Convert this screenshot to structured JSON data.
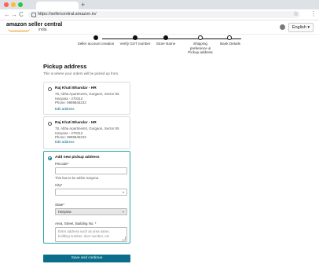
{
  "browser": {
    "url": "https://sellercentral.amazon.in/",
    "new_tab_symbol": "+",
    "back_icon": "←",
    "forward_icon": "→",
    "reload_icon": "C",
    "star_icon": "☆",
    "menu_icon": "⋮"
  },
  "header": {
    "logo_text": "amazon seller central",
    "logo_subtext": "india",
    "language": "English ▾"
  },
  "stepper": {
    "steps": [
      {
        "label": "Seller account creation",
        "status": "done"
      },
      {
        "label": "Verify GST number",
        "status": "done"
      },
      {
        "label": "Store Name",
        "status": "done"
      },
      {
        "label": "Shipping preference & Pickup address",
        "status": "current"
      },
      {
        "label": "Bank Details",
        "status": "todo"
      }
    ]
  },
  "page": {
    "title": "Pickup address",
    "subtitle": "This is where your orders will be picked up from."
  },
  "addresses": [
    {
      "name": "Raj Khati Bhandar - HR",
      "line1": "78, Abha Apartments, Gurgaon, Sector 55",
      "line2": "Haryana - 270312",
      "phone": "Phone: 9999845233",
      "edit_label": "Edit address"
    },
    {
      "name": "Raj Khati Bhandar - HR",
      "line1": "78, Abha Apartments, Gurgaon, Sector 55",
      "line2": "Haryana - 270312",
      "phone": "Phone: 9999845233",
      "edit_label": "Edit address"
    }
  ],
  "new_address": {
    "heading": "Add new pickup address",
    "pincode_label": "Pincode*",
    "pincode_value": "",
    "pincode_help": "This has to be within Haryana",
    "city_label": "City*",
    "city_value": "",
    "state_label": "State*",
    "state_value": "Haryana",
    "street_label": "Area, Street, Building No. *",
    "street_placeholder": "Enter address such as area name, building number, door number, etc."
  },
  "save_button": "Save and continue",
  "colors": {
    "accent": "#007185",
    "selected_border": "#2aa6a0",
    "button": "#0a6e8a",
    "logo_orange": "#f08804"
  }
}
